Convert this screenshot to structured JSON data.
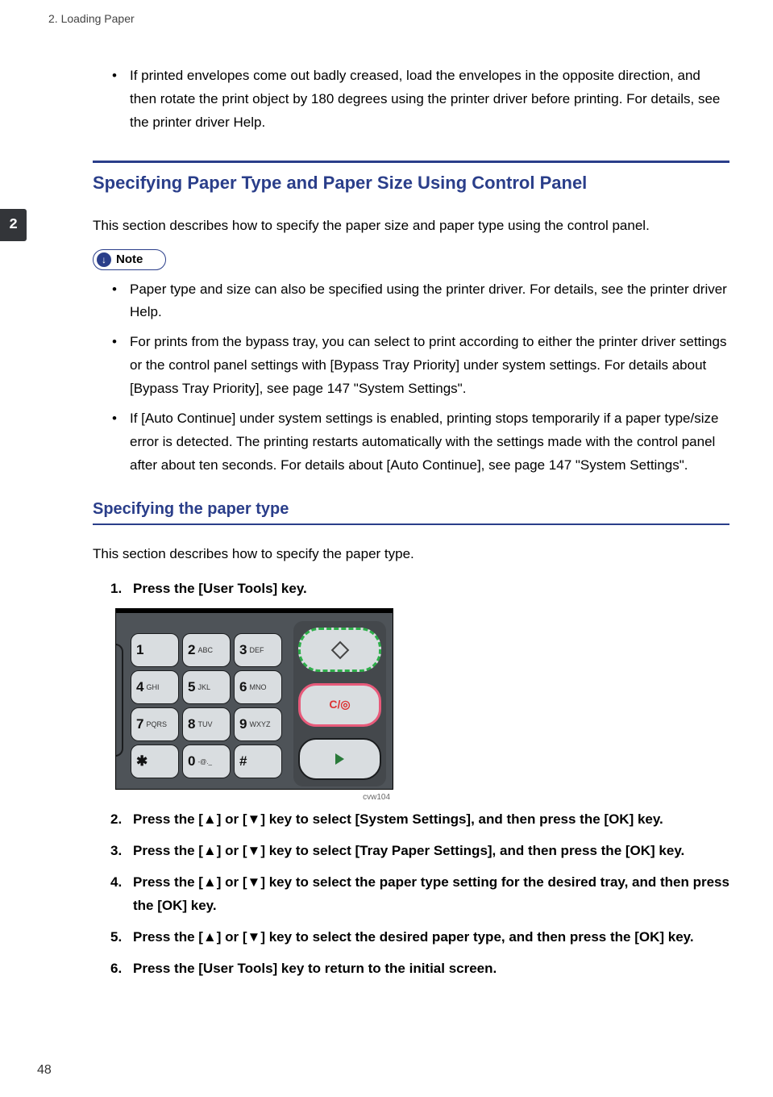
{
  "header_text": "2. Loading Paper",
  "chapter_tab": "2",
  "page_number": "48",
  "top_bullet": "If printed envelopes come out badly creased, load the envelopes in the opposite direction, and then rotate the print object by 180 degrees using the printer driver before printing. For details, see the printer driver Help.",
  "section1": {
    "heading": "Specifying Paper Type and Paper Size Using Control Panel",
    "intro": "This section describes how to specify the paper size and paper type using the control panel.",
    "note_label": "Note",
    "note_items": [
      "Paper type and size can also be specified using the printer driver. For details, see the printer driver Help.",
      "For prints from the bypass tray, you can select to print according to either the printer driver settings or the control panel settings with [Bypass Tray Priority] under system settings. For details about [Bypass Tray Priority], see page 147 \"System Settings\".",
      "If [Auto Continue] under system settings is enabled, printing stops temporarily if a paper type/size error is detected. The printing restarts automatically with the settings made with the control panel after about ten seconds. For details about [Auto Continue], see page 147 \"System Settings\"."
    ]
  },
  "section2": {
    "heading": "Specifying the paper type",
    "intro": "This section describes how to specify the paper type.",
    "steps": [
      "Press the [User Tools] key.",
      "Press the [▲] or [▼] key to select [System Settings], and then press the [OK] key.",
      "Press the [▲] or [▼] key to select [Tray Paper Settings], and then press the [OK] key.",
      "Press the [▲] or [▼] key to select the paper type setting for the desired tray, and then press the [OK] key.",
      "Press the [▲] or [▼] key to select the desired paper type, and then press the [OK] key.",
      "Press the [User Tools] key to return to the initial screen."
    ],
    "figure_label": "cvw104",
    "keypad": {
      "keys": [
        {
          "d": "1",
          "l": ""
        },
        {
          "d": "2",
          "l": "ABC"
        },
        {
          "d": "3",
          "l": "DEF"
        },
        {
          "d": "4",
          "l": "GHI"
        },
        {
          "d": "5",
          "l": "JKL"
        },
        {
          "d": "6",
          "l": "MNO"
        },
        {
          "d": "7",
          "l": "PQRS"
        },
        {
          "d": "8",
          "l": "TUV"
        },
        {
          "d": "9",
          "l": "WXYZ"
        },
        {
          "d": "✱",
          "l": ""
        },
        {
          "d": "0",
          "l": "-@._"
        },
        {
          "d": "#",
          "l": ""
        }
      ],
      "stop_label": "C/◎"
    }
  }
}
